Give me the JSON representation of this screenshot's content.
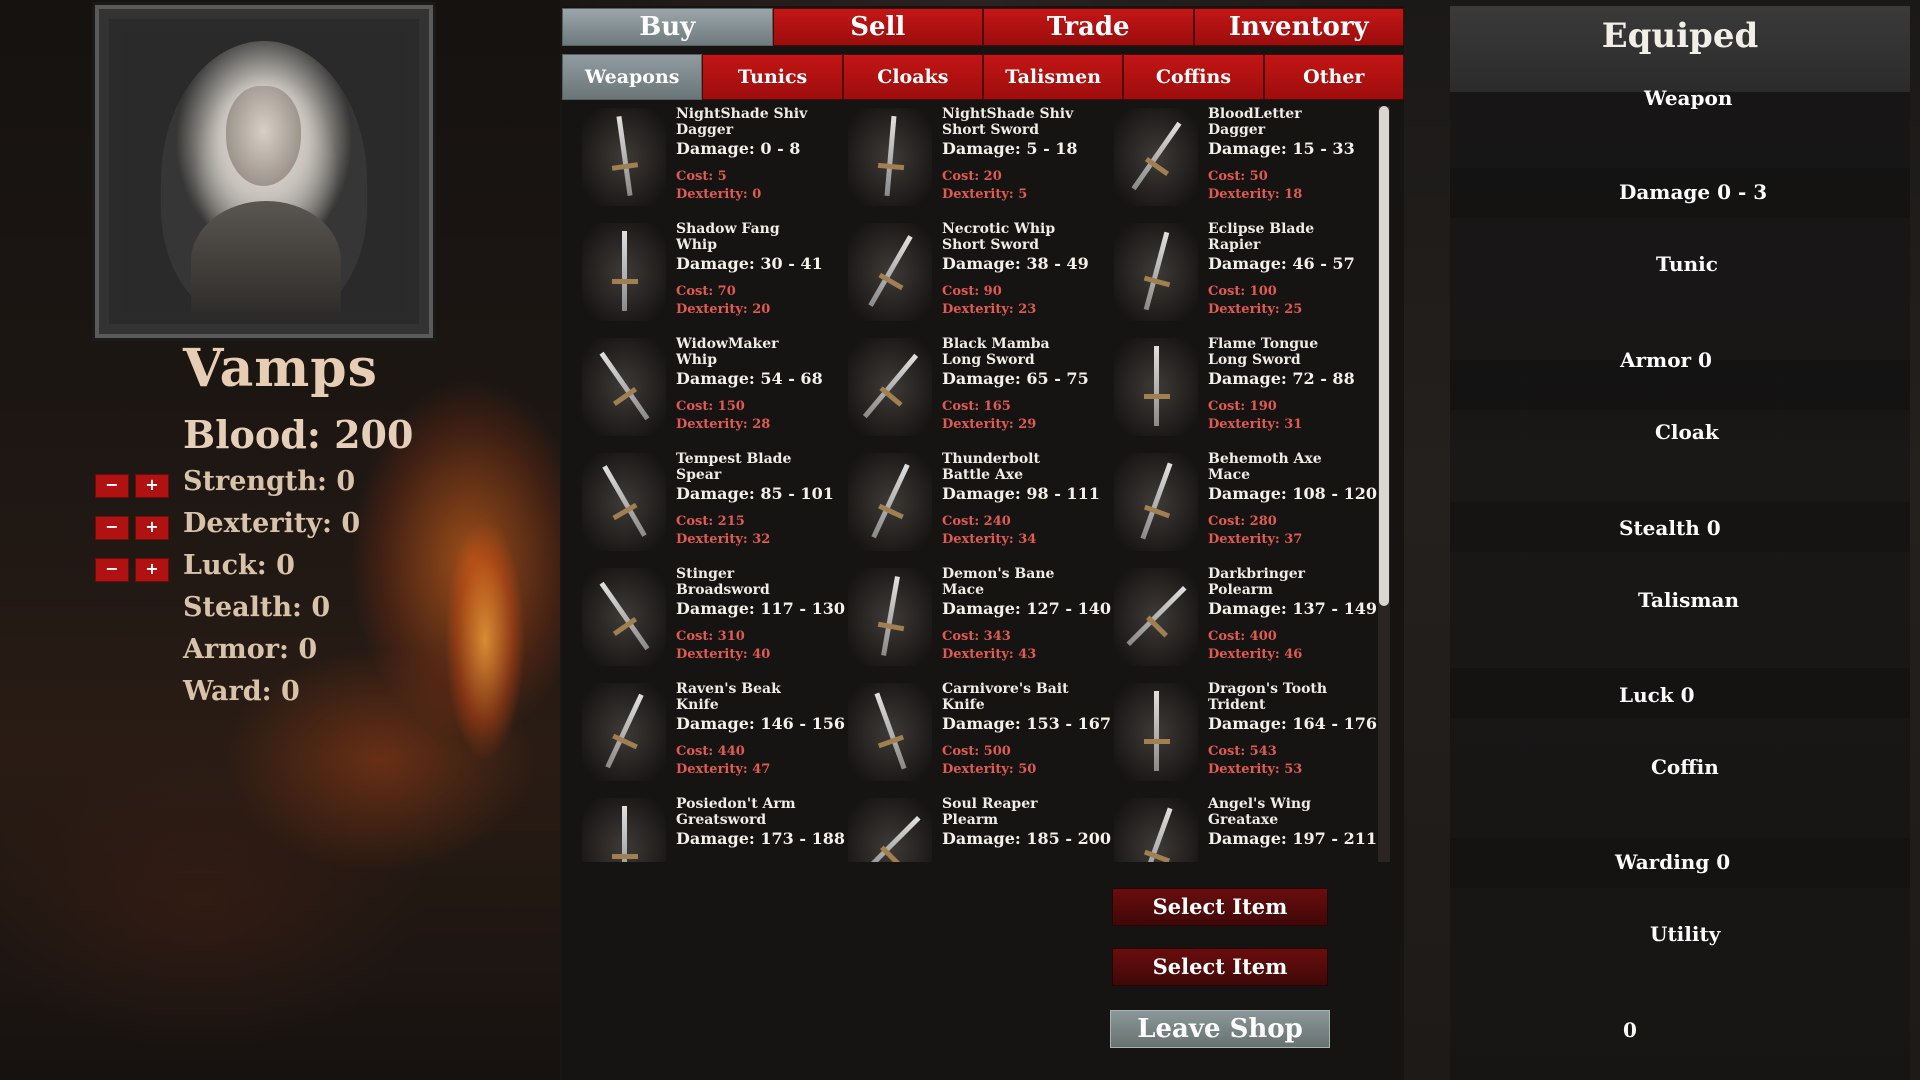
{
  "character": {
    "name": "Vamps",
    "blood": "Blood: 200",
    "stats": [
      {
        "label": "Strength: 0",
        "adjustable": true
      },
      {
        "label": "Dexterity: 0",
        "adjustable": true
      },
      {
        "label": "Luck: 0",
        "adjustable": true
      },
      {
        "label": "Stealth: 0",
        "adjustable": false
      },
      {
        "label": "Armor: 0",
        "adjustable": false
      },
      {
        "label": "Ward: 0",
        "adjustable": false
      }
    ],
    "minus_label": "−",
    "plus_label": "+"
  },
  "main_tabs": [
    {
      "label": "Buy",
      "active": true
    },
    {
      "label": "Sell",
      "active": false
    },
    {
      "label": "Trade",
      "active": false
    },
    {
      "label": "Inventory",
      "active": false
    }
  ],
  "sub_tabs": [
    {
      "label": "Weapons",
      "active": true
    },
    {
      "label": "Tunics",
      "active": false
    },
    {
      "label": "Cloaks",
      "active": false
    },
    {
      "label": "Talismen",
      "active": false
    },
    {
      "label": "Coffins",
      "active": false
    },
    {
      "label": "Other",
      "active": false
    }
  ],
  "items": [
    {
      "name": "NightShade Shiv",
      "type": "Dagger",
      "damage": "Damage: 0 - 8",
      "cost": "Cost: 5",
      "dex": "Dexterity: 0"
    },
    {
      "name": "NightShade Shiv",
      "type": "Short Sword",
      "damage": "Damage: 5 - 18",
      "cost": "Cost: 20",
      "dex": "Dexterity: 5"
    },
    {
      "name": "BloodLetter",
      "type": "Dagger",
      "damage": "Damage: 15 - 33",
      "cost": "Cost: 50",
      "dex": "Dexterity: 18"
    },
    {
      "name": "Shadow Fang",
      "type": "Whip",
      "damage": "Damage: 30 - 41",
      "cost": "Cost: 70",
      "dex": "Dexterity: 20"
    },
    {
      "name": "Necrotic Whip",
      "type": "Short Sword",
      "damage": "Damage: 38 - 49",
      "cost": "Cost: 90",
      "dex": "Dexterity: 23"
    },
    {
      "name": "Eclipse Blade",
      "type": "Rapier",
      "damage": "Damage: 46 - 57",
      "cost": "Cost: 100",
      "dex": "Dexterity: 25"
    },
    {
      "name": "WidowMaker",
      "type": "Whip",
      "damage": "Damage: 54 - 68",
      "cost": "Cost: 150",
      "dex": "Dexterity: 28"
    },
    {
      "name": "Black Mamba",
      "type": "Long Sword",
      "damage": "Damage: 65 - 75",
      "cost": "Cost: 165",
      "dex": "Dexterity: 29"
    },
    {
      "name": "Flame Tongue",
      "type": "Long Sword",
      "damage": "Damage: 72 - 88",
      "cost": "Cost: 190",
      "dex": "Dexterity: 31"
    },
    {
      "name": "Tempest Blade",
      "type": "Spear",
      "damage": "Damage: 85 - 101",
      "cost": "Cost: 215",
      "dex": "Dexterity: 32"
    },
    {
      "name": "Thunderbolt",
      "type": "Battle Axe",
      "damage": "Damage: 98 - 111",
      "cost": "Cost: 240",
      "dex": "Dexterity: 34"
    },
    {
      "name": "Behemoth Axe",
      "type": "Mace",
      "damage": "Damage: 108 - 120",
      "cost": "Cost: 280",
      "dex": "Dexterity: 37"
    },
    {
      "name": "Stinger",
      "type": "Broadsword",
      "damage": "Damage: 117 - 130",
      "cost": "Cost: 310",
      "dex": "Dexterity: 40"
    },
    {
      "name": "Demon's Bane",
      "type": "Mace",
      "damage": "Damage: 127 - 140",
      "cost": "Cost: 343",
      "dex": "Dexterity: 43"
    },
    {
      "name": "Darkbringer",
      "type": "Polearm",
      "damage": "Damage: 137 - 149",
      "cost": "Cost: 400",
      "dex": "Dexterity: 46"
    },
    {
      "name": "Raven's Beak",
      "type": "Knife",
      "damage": "Damage: 146 - 156",
      "cost": "Cost: 440",
      "dex": "Dexterity: 47"
    },
    {
      "name": "Carnivore's Bait",
      "type": "Knife",
      "damage": "Damage: 153 - 167",
      "cost": "Cost: 500",
      "dex": "Dexterity: 50"
    },
    {
      "name": "Dragon's Tooth",
      "type": "Trident",
      "damage": "Damage: 164 - 176",
      "cost": "Cost: 543",
      "dex": "Dexterity: 53"
    },
    {
      "name": "Posiedon't Arm",
      "type": "Greatsword",
      "damage": "Damage: 173 - 188",
      "cost": "",
      "dex": ""
    },
    {
      "name": "Soul Reaper",
      "type": "Plearm",
      "damage": "Damage: 185 - 200",
      "cost": "",
      "dex": ""
    },
    {
      "name": "Angel's Wing",
      "type": "Greataxe",
      "damage": "Damage: 197 - 211",
      "cost": "",
      "dex": ""
    }
  ],
  "actions": {
    "select_1": "Select Item",
    "select_2": "Select Item",
    "leave": "Leave Shop"
  },
  "equipped": {
    "title": "Equiped",
    "weapon": "Weapon",
    "damage": "Damage 0 - 3",
    "tunic": "Tunic",
    "armor": "Armor 0",
    "cloak": "Cloak",
    "stealth": "Stealth 0",
    "talisman": "Talisman",
    "luck": "Luck 0",
    "coffin": "Coffin",
    "warding": "Warding 0",
    "utility": "Utility",
    "utility_value": "0"
  }
}
